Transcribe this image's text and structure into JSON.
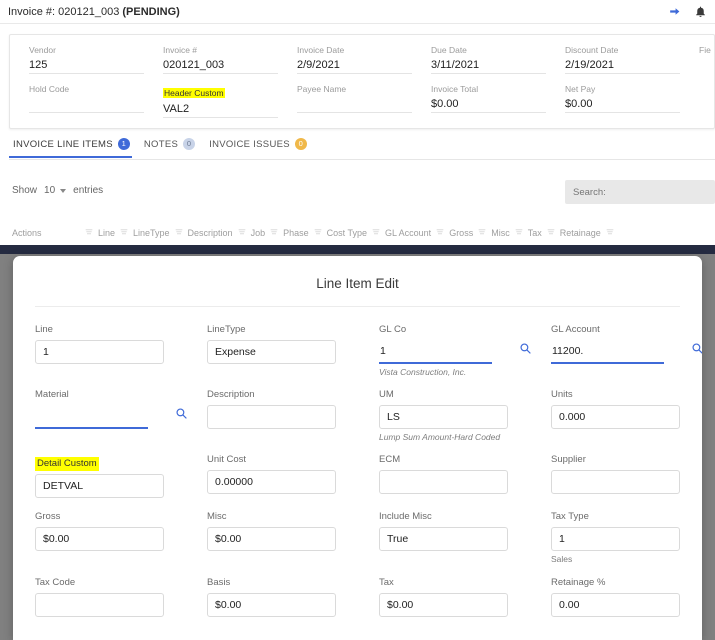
{
  "topbar": {
    "title_prefix": "Invoice #: 020121_003 ",
    "status": "(PENDING)",
    "forward_icon": "arrow-right-icon",
    "bell_icon": "bell-icon"
  },
  "header_card": {
    "fields": [
      {
        "label": "Vendor",
        "value": "125",
        "highlight": false
      },
      {
        "label": "Invoice #",
        "value": "020121_003",
        "highlight": false
      },
      {
        "label": "Invoice Date",
        "value": "2/9/2021",
        "highlight": false
      },
      {
        "label": "Due Date",
        "value": "3/11/2021",
        "highlight": false
      },
      {
        "label": "Discount Date",
        "value": "2/19/2021",
        "highlight": false
      },
      {
        "label": "Fie",
        "value": "",
        "highlight": false
      }
    ],
    "fields2": [
      {
        "label": "Hold Code",
        "value": "",
        "highlight": false
      },
      {
        "label": "Header Custom",
        "value": "VAL2",
        "highlight": true
      },
      {
        "label": "Payee Name",
        "value": "",
        "highlight": false
      },
      {
        "label": "Invoice Total",
        "value": "$0.00",
        "highlight": false
      },
      {
        "label": "Net Pay",
        "value": "$0.00",
        "highlight": false
      },
      {
        "label": "",
        "value": "",
        "highlight": false
      }
    ]
  },
  "tabs": [
    {
      "label": "INVOICE LINE ITEMS",
      "badge": "1",
      "badge_color": "blue",
      "active": true
    },
    {
      "label": "NOTES",
      "badge": "0",
      "badge_color": "grey",
      "active": false
    },
    {
      "label": "INVOICE ISSUES",
      "badge": "0",
      "badge_color": "orange",
      "active": false
    }
  ],
  "table_controls": {
    "show_label": "Show",
    "page_size": "10",
    "entries_label": "entries",
    "search_placeholder": "Search:"
  },
  "table_headers": [
    "Actions",
    "Line",
    "LineType",
    "Description",
    "Job",
    "Phase",
    "Cost Type",
    "GL Account",
    "Gross",
    "Misc",
    "Tax",
    "Retainage"
  ],
  "modal": {
    "title": "Line Item Edit",
    "rows": [
      [
        {
          "label": "Line",
          "value": "1",
          "focused": false,
          "icon": false,
          "hint": ""
        },
        {
          "label": "LineType",
          "value": "Expense",
          "focused": false,
          "icon": false,
          "hint": ""
        },
        {
          "label": "GL Co",
          "value": "1",
          "focused": true,
          "icon": true,
          "hint": "Vista Construction, Inc."
        },
        {
          "label": "GL Account",
          "value": "11200.",
          "focused": true,
          "icon": true,
          "hint": ""
        }
      ],
      [
        {
          "label": "Material",
          "value": "",
          "focused": true,
          "icon": true,
          "hint": ""
        },
        {
          "label": "Description",
          "value": "",
          "focused": false,
          "icon": false,
          "hint": ""
        },
        {
          "label": "UM",
          "value": "LS",
          "focused": false,
          "icon": false,
          "hint": "Lump Sum Amount-Hard Coded"
        },
        {
          "label": "Units",
          "value": "0.000",
          "focused": false,
          "icon": false,
          "hint": ""
        }
      ],
      [
        {
          "label": "Detail Custom",
          "value": "DETVAL",
          "focused": false,
          "icon": false,
          "hint": "",
          "highlight": true
        },
        {
          "label": "Unit Cost",
          "value": "0.00000",
          "focused": false,
          "icon": false,
          "hint": ""
        },
        {
          "label": "ECM",
          "value": "",
          "focused": false,
          "icon": false,
          "hint": ""
        },
        {
          "label": "Supplier",
          "value": "",
          "focused": false,
          "icon": false,
          "hint": ""
        }
      ],
      [
        {
          "label": "Gross",
          "value": "$0.00",
          "focused": false,
          "icon": false,
          "hint": ""
        },
        {
          "label": "Misc",
          "value": "$0.00",
          "focused": false,
          "icon": false,
          "hint": ""
        },
        {
          "label": "Include Misc",
          "value": "True",
          "focused": false,
          "icon": false,
          "hint": ""
        },
        {
          "label": "Tax Type",
          "value": "1",
          "focused": false,
          "icon": false,
          "hint": "Sales",
          "hint_plain": true
        }
      ],
      [
        {
          "label": "Tax Code",
          "value": "",
          "focused": false,
          "icon": false,
          "hint": ""
        },
        {
          "label": "Basis",
          "value": "$0.00",
          "focused": false,
          "icon": false,
          "hint": ""
        },
        {
          "label": "Tax",
          "value": "$0.00",
          "focused": false,
          "icon": false,
          "hint": ""
        },
        {
          "label": "Retainage %",
          "value": "0.00",
          "focused": false,
          "icon": false,
          "hint": ""
        }
      ]
    ]
  },
  "colors": {
    "accent": "#3f6ad8",
    "highlight": "#ffff00",
    "dark_bar": "#252b41",
    "overlay": "#808080",
    "badge_orange": "#f0b849"
  }
}
